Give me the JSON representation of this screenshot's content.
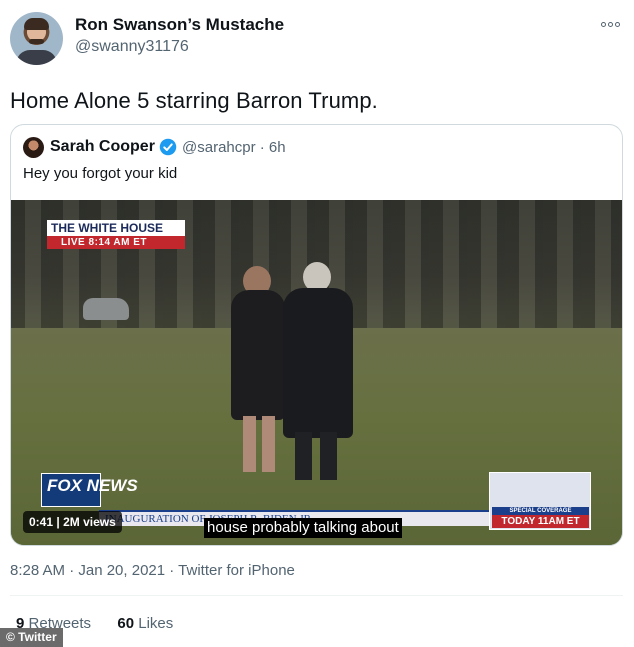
{
  "author": {
    "display_name": "Ron Swanson’s Mustache",
    "handle": "@swanny31176"
  },
  "more_icon": "more-dots-icon",
  "tweet_text": "Home Alone 5 starring Barron Trump.",
  "quoted_tweet": {
    "display_name": "Sarah Cooper",
    "verified_icon": "verified-badge-icon",
    "meta": "@sarahcpr · 6h",
    "text": "Hey you forgot your kid",
    "video": {
      "banner_title": "THE WHITE HOUSE",
      "banner_live": "LIVE  8:14 AM ET",
      "network_logo": "FOX NEWS",
      "ticker_text": "INAUGURATION OF JOSEPH R. BIDEN JR.",
      "special_label": "SPECIAL COVERAGE",
      "special_time": "TODAY 11AM ET",
      "caption": "house probably talking about",
      "duration": "0:41",
      "views": "2M views"
    }
  },
  "footer": {
    "timestamp": "8:28 AM · Jan 20, 2021 · Twitter for iPhone",
    "retweets_count": "9",
    "retweets_label": "Retweets",
    "likes_count": "60",
    "likes_label": "Likes"
  },
  "watermark": "© Twitter"
}
